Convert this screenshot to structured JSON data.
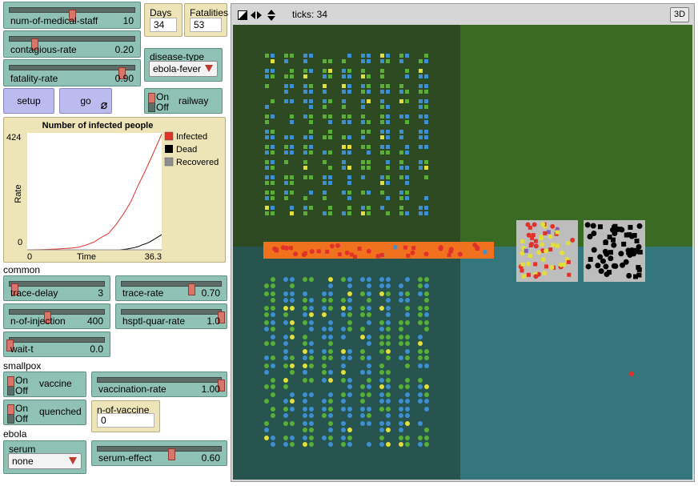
{
  "sliders": {
    "num_of_medical_staff": {
      "label": "num-of-medical-staff",
      "value": "10",
      "level": 0.5
    },
    "contagious_rate": {
      "label": "contagious-rate",
      "value": "0.20",
      "level": 0.2
    },
    "fatality_rate": {
      "label": "fatality-rate",
      "value": "0.90",
      "level": 0.9
    },
    "trace_delay": {
      "label": "trace-delay",
      "value": "3",
      "level": 0.05
    },
    "trace_rate": {
      "label": "trace-rate",
      "value": "0.70",
      "level": 0.7
    },
    "n_of_injection": {
      "label": "n-of-injection",
      "value": "400",
      "level": 0.4
    },
    "hsptl_quar_rate": {
      "label": "hsptl-quar-rate",
      "value": "1.0",
      "level": 1.0
    },
    "wait_t": {
      "label": "wait-t",
      "value": "0.0",
      "level": 0.0
    },
    "vaccination_rate": {
      "label": "vaccination-rate",
      "value": "1.00",
      "level": 1.0
    },
    "serum_effect": {
      "label": "serum-effect",
      "value": "0.60",
      "level": 0.6
    }
  },
  "monitors": {
    "days": {
      "label": "Days",
      "value": "34"
    },
    "fatalities": {
      "label": "Fatalities",
      "value": "53"
    },
    "n_of_vaccine": {
      "label": "n-of-vaccine",
      "value": "0"
    }
  },
  "disease_type": {
    "label": "disease-type",
    "value": "ebola-fever"
  },
  "serum": {
    "label": "serum",
    "value": "none"
  },
  "buttons": {
    "setup": "setup",
    "go": "go"
  },
  "switches": {
    "railway": {
      "on": "On",
      "off": "Off",
      "label": "railway"
    },
    "vaccine": {
      "on": "On",
      "off": "Off",
      "label": "vaccine"
    },
    "quenched": {
      "on": "On",
      "off": "Off",
      "label": "quenched"
    }
  },
  "sections": {
    "common": "common",
    "smallpox": "smallpox",
    "ebola": "ebola"
  },
  "view": {
    "ticks_label": "ticks: 34",
    "three_d": "3D"
  },
  "colors": {
    "infected": "#e0322b",
    "dead": "#000000",
    "recovered": "#8e8e8e",
    "quadrant_tl": "#2e4a22",
    "quadrant_tr": "#3a6a24",
    "quadrant_bl": "#27544f",
    "quadrant_br": "#34767b",
    "railway": "#f0721f"
  },
  "chart_data": {
    "type": "line",
    "title": "Number of infected people",
    "xlabel": "Time",
    "ylabel": "Rate",
    "xlim": [
      0,
      36.3
    ],
    "ylim": [
      0,
      424
    ],
    "x_tick_labels": [
      "0",
      "36.3"
    ],
    "y_tick_labels": [
      "0",
      "424"
    ],
    "legend": [
      "Infected",
      "Dead",
      "Recovered"
    ],
    "series": [
      {
        "name": "Infected",
        "color": "#e0322b",
        "x": [
          0,
          4,
          8,
          12,
          14,
          16,
          18,
          20,
          22,
          24,
          26,
          28,
          30,
          32,
          34,
          36.3
        ],
        "y": [
          0,
          1,
          3,
          6,
          10,
          18,
          28,
          45,
          60,
          92,
          130,
          175,
          235,
          290,
          350,
          420
        ]
      },
      {
        "name": "Dead",
        "color": "#000000",
        "x": [
          0,
          25,
          27,
          29,
          30,
          31,
          32,
          33,
          34,
          35,
          36.3
        ],
        "y": [
          0,
          0,
          3,
          8,
          12,
          18,
          22,
          28,
          36,
          44,
          55
        ]
      },
      {
        "name": "Recovered",
        "color": "#8e8e8e",
        "x": [
          0,
          36.3
        ],
        "y": [
          0,
          0
        ]
      }
    ]
  }
}
